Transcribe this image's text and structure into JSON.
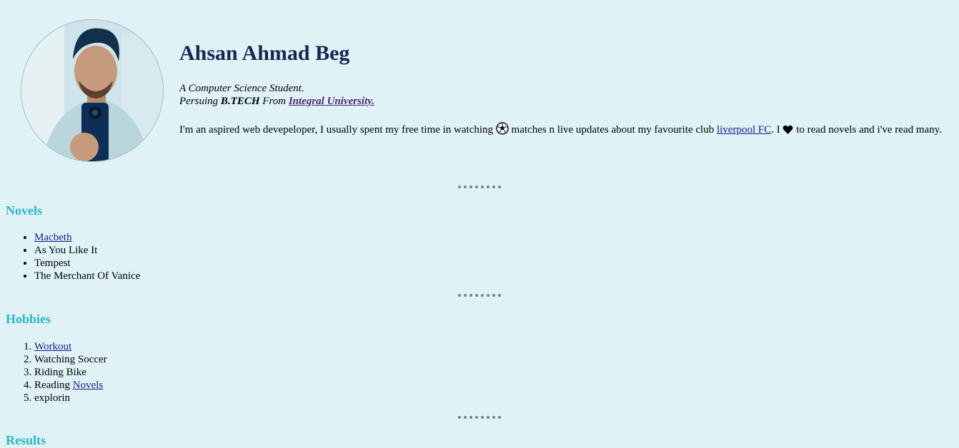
{
  "profile": {
    "name": "Ahsan Ahmad Beg",
    "tagline_line1": "A Computer Science Student.",
    "tagline_prefix": "Persuing ",
    "degree": "B.TECH",
    "tagline_mid": " From ",
    "university": "Integral University.",
    "bio_part1": "I'm an aspired web devepeloper, I usually spent my free time in watching ",
    "bio_part2": " matches n live updates about my favourite club ",
    "club_link": "liverpool FC",
    "bio_part3": ". I ",
    "bio_part4": " to read novels and i've read many.",
    "soccer_icon": "soccer-ball-icon",
    "heart_icon": "black-heart-icon"
  },
  "novels": {
    "title": "Novels",
    "items": [
      "Macbeth",
      "As You Like It",
      "Tempest",
      "The Merchant Of Vanice"
    ]
  },
  "hobbies": {
    "title": "Hobbies",
    "items": [
      "Workout",
      "Watching Soccer",
      "Riding Bike",
      "Reading ",
      "explorin"
    ],
    "reading_link": "Novels"
  },
  "results": {
    "title": "Results"
  },
  "colors": {
    "background": "#dff3f7",
    "name": "#1b2455",
    "section_title": "#2bb6c2",
    "link": "#1a1a8a",
    "visited_link": "#4a2770"
  }
}
